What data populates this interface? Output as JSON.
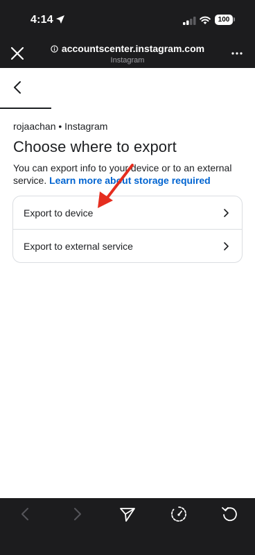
{
  "status_bar": {
    "time": "4:14",
    "battery": "100",
    "icons": [
      "location-arrow-icon",
      "cellular-signal-icon",
      "wifi-icon",
      "battery-icon"
    ]
  },
  "browser": {
    "url": "accountscenter.instagram.com",
    "site_name": "Instagram",
    "icons": [
      "close-icon",
      "info-icon",
      "more-options-icon"
    ]
  },
  "page": {
    "account_line": "rojaachan • Instagram",
    "title": "Choose where to export",
    "description": "You can export info to your device or to an external service.",
    "learn_more_link": "Learn more about storage required",
    "options": [
      {
        "label": "Export to device",
        "icon": "chevron-right-icon"
      },
      {
        "label": "Export to external service",
        "icon": "chevron-right-icon"
      }
    ]
  },
  "toolbar": {
    "buttons": [
      "back-arrow-icon",
      "forward-arrow-icon",
      "share-send-icon",
      "speed-gauge-icon",
      "refresh-icon"
    ]
  },
  "colors": {
    "chrome_background": "#1c1c1e",
    "link": "#0064d1",
    "annotation_arrow": "#e52d1f",
    "card_border": "#dadde1"
  }
}
